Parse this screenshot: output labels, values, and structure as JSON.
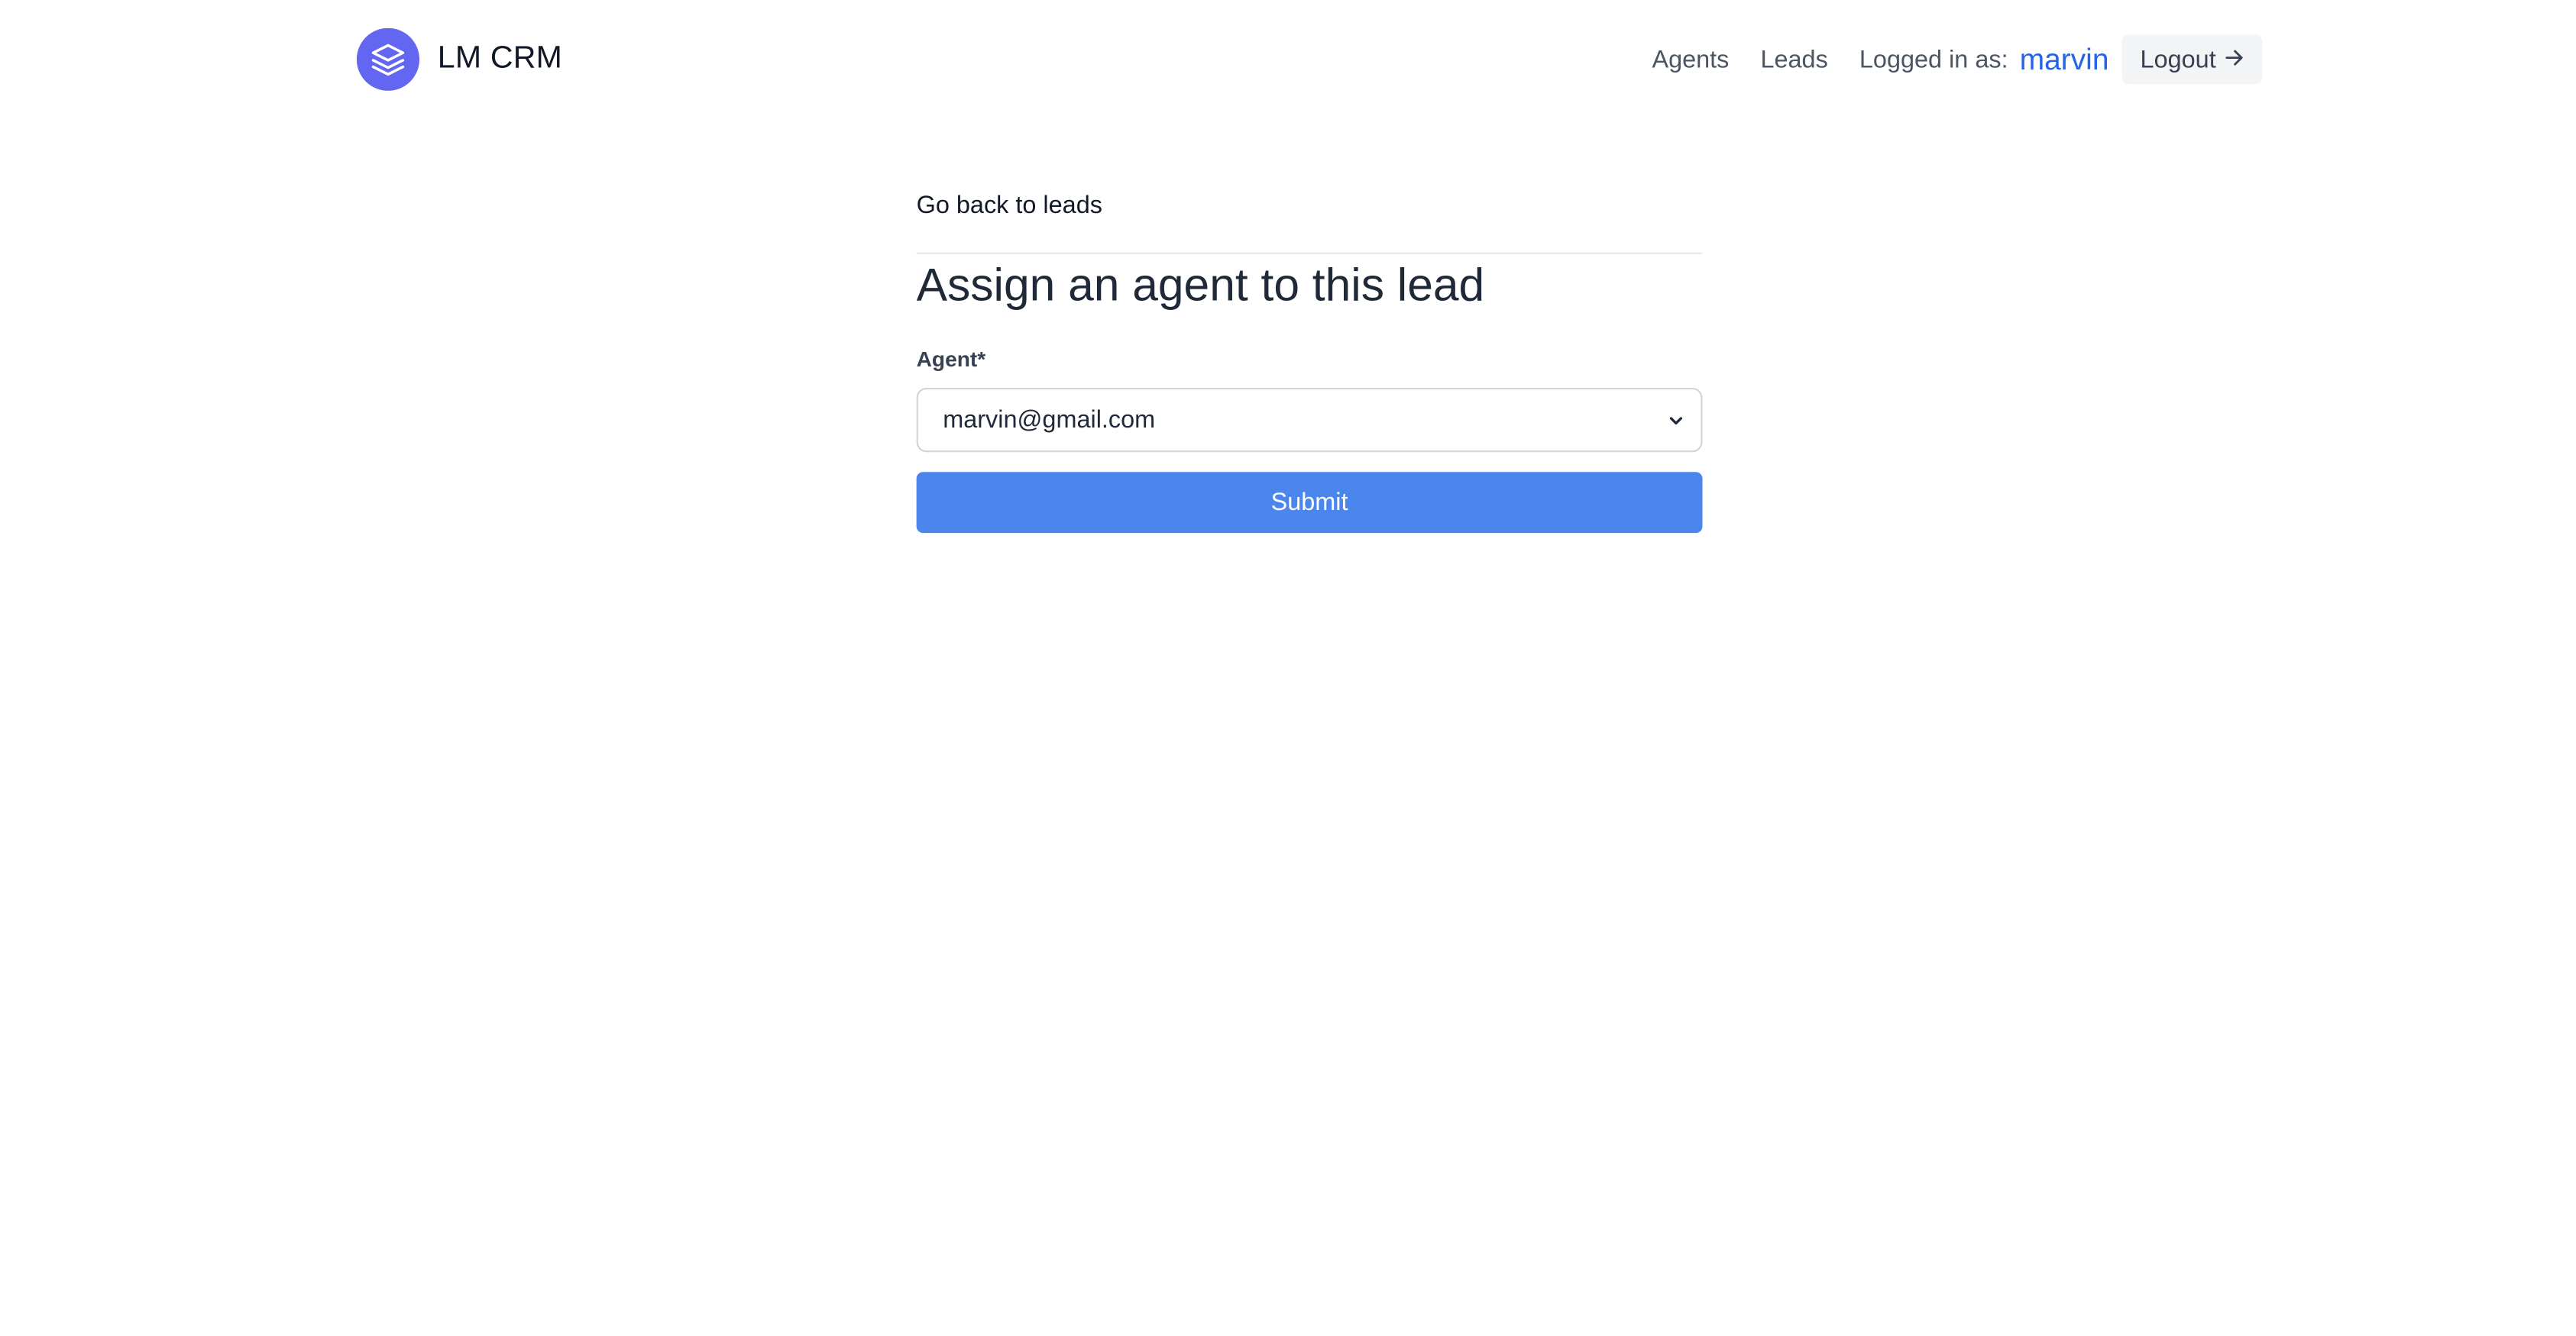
{
  "header": {
    "brand_name": "LM CRM",
    "logo_icon": "layers-icon",
    "nav": {
      "agents_label": "Agents",
      "leads_label": "Leads"
    },
    "logged_in_label": "Logged in as:",
    "username": "marvin",
    "logout_label": "Logout",
    "logout_icon": "arrow-right-icon"
  },
  "main": {
    "back_link": "Go back to leads",
    "title": "Assign an agent to this lead",
    "form": {
      "agent_label": "Agent*",
      "agent_selected": "marvin@gmail.com",
      "submit_label": "Submit"
    }
  },
  "colors": {
    "brand": "#6366f1",
    "accent_link": "#2563eb",
    "submit_button": "#4a86ec",
    "logout_background": "#f3f4f6",
    "page_background": "#ffffff"
  }
}
